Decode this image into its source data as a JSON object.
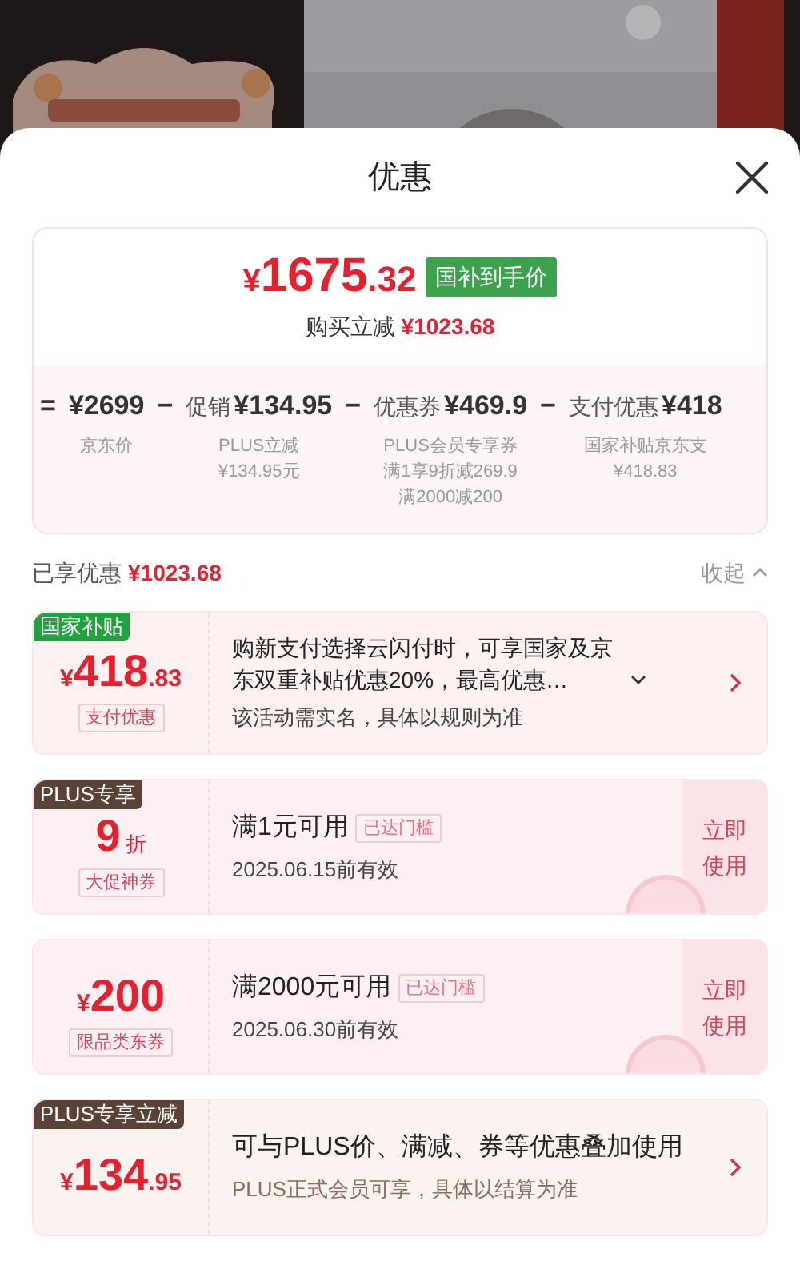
{
  "sheet": {
    "title": "优惠"
  },
  "summary": {
    "symbol": "¥",
    "price_int": "1675",
    "price_dec": ".32",
    "price_tag": "国补到手价",
    "saving_label": "购买立减",
    "saving_amount": "¥1023.68",
    "breakdown": [
      {
        "op": "=",
        "amount": "¥2699",
        "notes": [
          "京东价"
        ]
      },
      {
        "op": "−",
        "label": "促销",
        "amount": "¥134.95",
        "notes": [
          "PLUS立减",
          "¥134.95元"
        ]
      },
      {
        "op": "−",
        "label": "优惠券",
        "amount": "¥469.9",
        "notes": [
          "PLUS会员专享券",
          "满1享9折减269.9",
          "满2000减200"
        ]
      },
      {
        "op": "−",
        "label": "支付优惠",
        "amount": "¥418",
        "notes": [
          "国家补贴京东支",
          "¥418.83"
        ]
      }
    ]
  },
  "enjoyed": {
    "label": "已享优惠",
    "amount": "¥1023.68",
    "toggle": "收起",
    "expanded": true
  },
  "cards": [
    {
      "kind": "subsidy",
      "tag": "国家补贴",
      "symbol": "¥",
      "amount": "418",
      "decimal": ".83",
      "badge": "支付优惠",
      "title": "购新支付选择云闪付时，可享国家及京东双重补贴优惠20%，最高优惠…",
      "note": "该活动需实名，具体以规则为准"
    },
    {
      "kind": "coupon",
      "tag": "PLUS专享",
      "amount": "9",
      "unit": "折",
      "badge": "大促神券",
      "title": "满1元可用",
      "status": "已达门槛",
      "note": "2025.06.15前有效",
      "action": "立即使用",
      "claimed": true
    },
    {
      "kind": "coupon",
      "symbol": "¥",
      "amount": "200",
      "badge": "限品类东券",
      "title": "满2000元可用",
      "status": "已达门槛",
      "note": "2025.06.30前有效",
      "action": "立即使用",
      "claimed": true
    },
    {
      "kind": "plus",
      "tag": "PLUS专享立减",
      "symbol": "¥",
      "amount": "134",
      "decimal": ".95",
      "title": "可与PLUS价、满减、券等优惠叠加使用",
      "note": "PLUS正式会员可享，具体以结算为准"
    }
  ]
}
